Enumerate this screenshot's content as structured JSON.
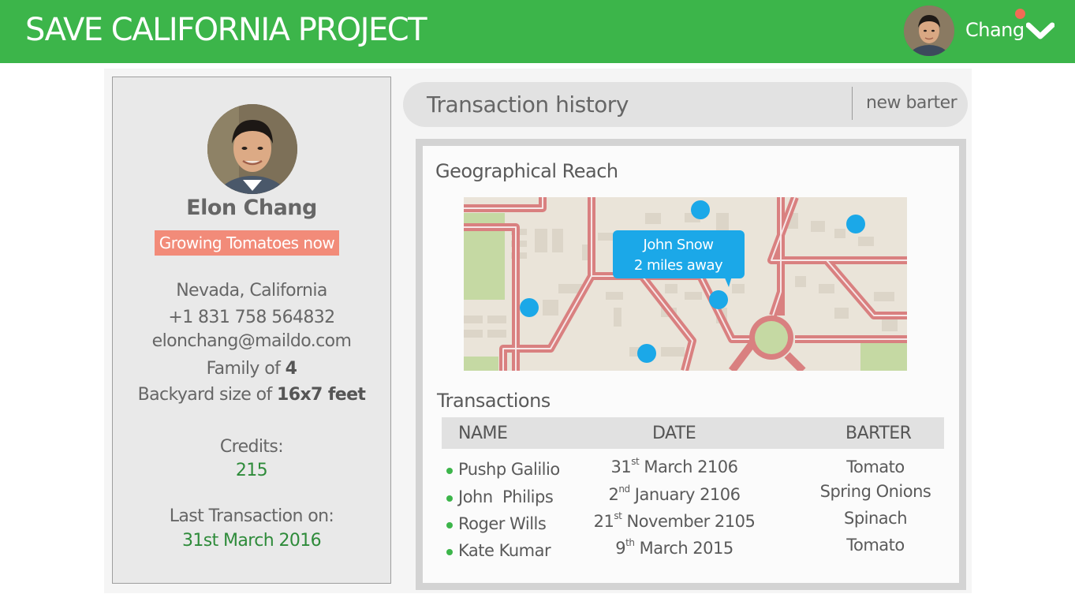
{
  "header": {
    "app_title": "SAVE CALIFORNIA PROJECT",
    "user_name": "Chang",
    "accent_color": "#3cb54a",
    "notification_color": "#f26b55"
  },
  "profile": {
    "name": "Elon Chang",
    "status": "Growing Tomatoes now",
    "location": "Nevada, California",
    "phone": "+1 831 758 564832",
    "email": "elonchang@maildo.com",
    "family_prefix": "Family of",
    "family_value": "4",
    "backyard_prefix": "Backyard size of",
    "backyard_value": "16x7 feet",
    "credits_label": "Credits:",
    "credits_value": "215",
    "last_tx_label": "Last Transaction on:",
    "last_tx_value": "31st March 2016"
  },
  "search": {
    "title": "Transaction history",
    "action": "new barter"
  },
  "geo": {
    "heading": "Geographical Reach",
    "callout_line1": "John Snow",
    "callout_line2": "2 miles away"
  },
  "transactions": {
    "heading": "Transactions",
    "columns": [
      "NAME",
      "DATE",
      "BARTER"
    ],
    "rows": [
      {
        "name": "Pushp Galilio",
        "day": "31",
        "suffix": "st",
        "date_rest": "March 2106",
        "barter": "Tomato"
      },
      {
        "name": "John  Philips",
        "day": "2",
        "suffix": "nd",
        "date_rest": "January 2106",
        "barter": "Spring Onions"
      },
      {
        "name": "Roger Wills",
        "day": "21",
        "suffix": "st",
        "date_rest": "November 2105",
        "barter": "Spinach"
      },
      {
        "name": "Kate Kumar",
        "day": "9",
        "suffix": "th",
        "date_rest": "March 2015",
        "barter": "Tomato"
      }
    ]
  }
}
